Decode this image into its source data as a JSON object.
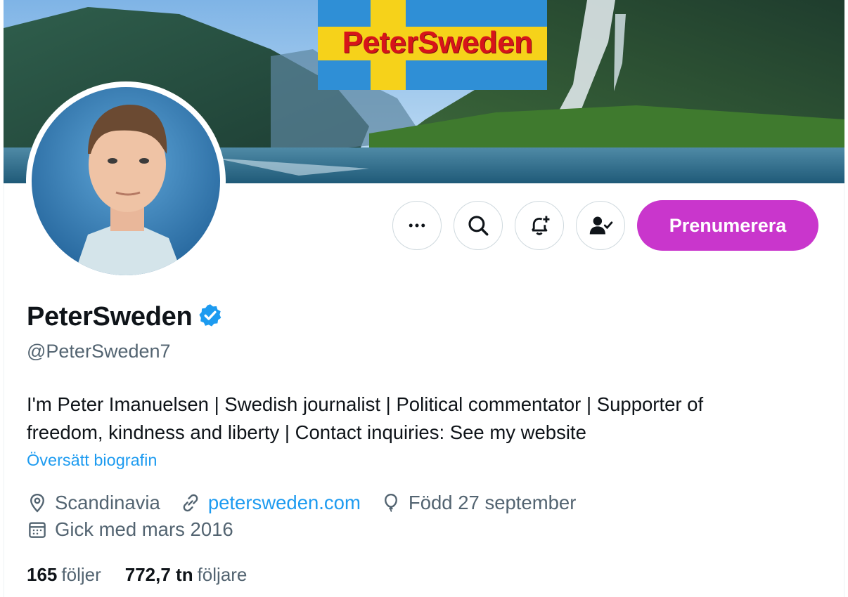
{
  "banner": {
    "logo_text": "PeterSweden"
  },
  "actions": {
    "more_label": "Mer",
    "search_label": "Sök",
    "notify_label": "Aviseringar",
    "following_label": "Följer",
    "subscribe_label": "Prenumerera"
  },
  "profile": {
    "display_name": "PeterSweden",
    "handle": "@PeterSweden7",
    "bio_line1": "I'm Peter Imanuelsen | Swedish journalist | Political commentator | Supporter of",
    "bio_line2": "freedom, kindness and liberty | Contact inquiries: See my website",
    "translate_label": "Översätt biografin",
    "location": "Scandinavia",
    "website": "petersweden.com",
    "birthday": "Född 27 september",
    "joined": "Gick med mars 2016"
  },
  "stats": {
    "following_count": "165",
    "following_label": "följer",
    "followers_count": "772,7 tn",
    "followers_label": "följare"
  },
  "colors": {
    "accent": "#1d9bf0",
    "subscribe": "#c936cc",
    "muted": "#536471",
    "text": "#0f1419"
  },
  "icons": [
    "more-icon",
    "search-icon",
    "bell-plus-icon",
    "person-check-icon",
    "verified-badge-icon",
    "location-pin-icon",
    "link-icon",
    "balloon-icon",
    "calendar-icon"
  ]
}
